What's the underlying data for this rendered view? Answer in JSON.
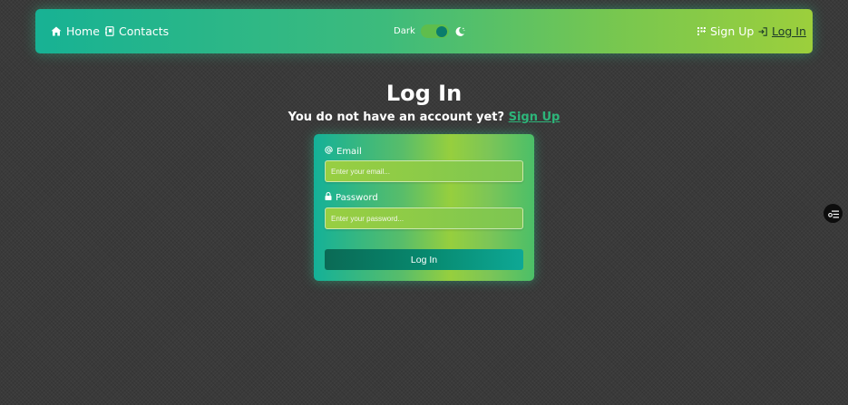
{
  "nav": {
    "home_label": "Home",
    "contacts_label": "Contacts",
    "theme_label": "Dark",
    "signup_label": "Sign Up",
    "login_label": "Log In"
  },
  "page": {
    "title": "Log In",
    "subtitle_text": "You do not have an account yet?",
    "subtitle_link": "Sign Up"
  },
  "form": {
    "email_label": "Email",
    "email_placeholder": "Enter your email...",
    "email_value": "",
    "password_label": "Password",
    "password_placeholder": "Enter your password...",
    "password_value": "",
    "submit_label": "Log In"
  },
  "icons": {
    "home": "home-icon",
    "contacts": "address-book-icon",
    "theme": "moon-icon",
    "signup": "grid-plus-icon",
    "login": "sign-in-icon",
    "email": "at-icon",
    "password": "lock-icon",
    "side": "filter-settings-icon"
  },
  "colors": {
    "nav_gradient_start": "#17b294",
    "nav_gradient_end": "#9ccf3c",
    "link_accent": "#2db67a",
    "button": "#07886e",
    "background": "#3a3a3a"
  },
  "theme_toggle": {
    "dark_mode_on": true
  }
}
